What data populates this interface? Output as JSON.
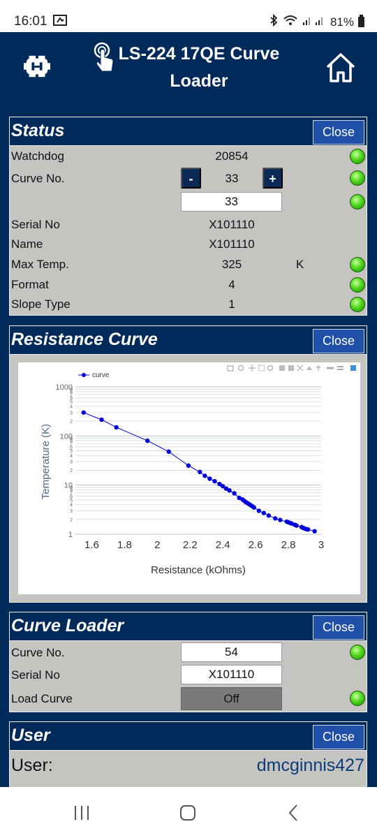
{
  "statusbar": {
    "time": "16:01",
    "battery": "81%"
  },
  "header": {
    "title": "LS-224 17QE Curve Loader"
  },
  "status_panel": {
    "title": "Status",
    "close_label": "Close",
    "rows": {
      "watchdog_label": "Watchdog",
      "watchdog_value": "20854",
      "curve_no_label": "Curve No.",
      "curve_no_value": "33",
      "curve_no_minus": "-",
      "curve_no_plus": "+",
      "curve_no_input": "33",
      "serial_label": "Serial No",
      "serial_value": "X101110",
      "name_label": "Name",
      "name_value": "X101110",
      "max_temp_label": "Max Temp.",
      "max_temp_value": "325",
      "max_temp_unit": "K",
      "format_label": "Format",
      "format_value": "4",
      "slope_label": "Slope Type",
      "slope_value": "1"
    }
  },
  "resistance_panel": {
    "title": "Resistance Curve",
    "close_label": "Close"
  },
  "chart_data": {
    "type": "scatter",
    "xlabel": "Resistance (kOhms)",
    "ylabel": "Temperature (K)",
    "xlim": [
      1.5,
      3.0
    ],
    "ylim": [
      1,
      1000
    ],
    "y_scale": "log",
    "grid": true,
    "legend_position": "top-left",
    "x_ticks": [
      "1.6",
      "1.8",
      "2",
      "2.2",
      "2.4",
      "2.6",
      "2.8",
      "3"
    ],
    "y_major_ticks": [
      "1000",
      "100",
      "10",
      "1"
    ],
    "y_minor_ticks": [
      "2",
      "3",
      "4",
      "5",
      "6",
      "7",
      "8",
      "9"
    ],
    "series": [
      {
        "name": "curve",
        "color": "#0000dd",
        "x": [
          1.55,
          1.66,
          1.75,
          1.94,
          2.07,
          2.19,
          2.26,
          2.29,
          2.32,
          2.35,
          2.38,
          2.4,
          2.42,
          2.44,
          2.47,
          2.5,
          2.52,
          2.53,
          2.54,
          2.55,
          2.56,
          2.57,
          2.58,
          2.59,
          2.62,
          2.65,
          2.68,
          2.72,
          2.75,
          2.79,
          2.8,
          2.81,
          2.82,
          2.84,
          2.85,
          2.88,
          2.89,
          2.9,
          2.91,
          2.92,
          2.96
        ],
        "y": [
          300,
          215,
          150,
          80,
          48,
          25,
          18.5,
          15.5,
          13.5,
          12,
          10.5,
          9.5,
          8.5,
          7.8,
          6.8,
          5.5,
          5.1,
          4.8,
          4.5,
          4.3,
          4.1,
          3.9,
          3.7,
          3.5,
          3.0,
          2.7,
          2.4,
          2.1,
          1.95,
          1.8,
          1.75,
          1.7,
          1.65,
          1.55,
          1.5,
          1.4,
          1.35,
          1.3,
          1.27,
          1.25,
          1.15
        ]
      }
    ]
  },
  "loader_panel": {
    "title": "Curve Loader",
    "close_label": "Close",
    "curve_no_label": "Curve No.",
    "curve_no_value": "54",
    "serial_label": "Serial No",
    "serial_value": "X101110",
    "load_label": "Load Curve",
    "load_value": "Off"
  },
  "user_panel": {
    "title": "User",
    "close_label": "Close",
    "user_label": "User:",
    "user_value": "dmcginnis427"
  }
}
